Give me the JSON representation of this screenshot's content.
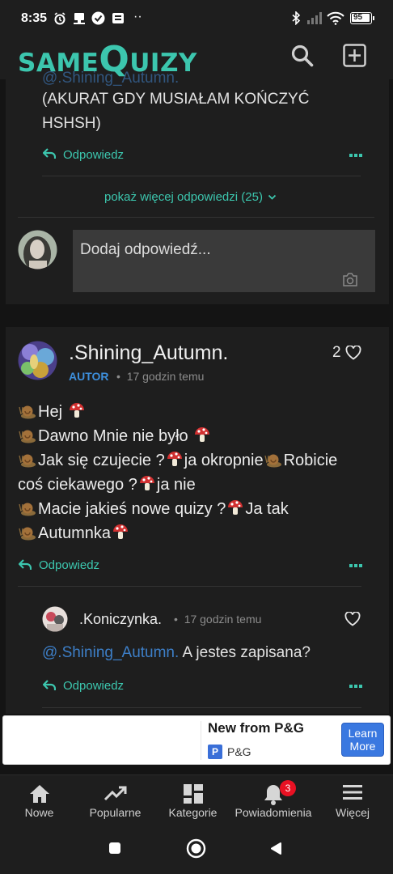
{
  "status_bar": {
    "time": "8:35",
    "battery": "95"
  },
  "app": {
    "logo_same": "same",
    "logo_q": "Q",
    "logo_uizy": "uizy"
  },
  "top_thread": {
    "mention_partial": "@.Shining_Autumn.",
    "text_line1": "(AKURAT GDY MUSIAŁAM KOŃCZYĆ",
    "text_line2": "HSHSH)",
    "reply_label": "Odpowiedz",
    "show_more": "pokaż więcej odpowiedzi (25)",
    "add_reply_placeholder": "Dodaj odpowiedź..."
  },
  "comment": {
    "author": ".Shining_Autumn.",
    "badge": "AUTOR",
    "time": "17 godzin temu",
    "likes": "2",
    "lines": [
      "Hej",
      "Dawno Mnie nie było",
      "Jak się czujecie ?",
      "ja okropnie",
      "Robicie",
      "coś ciekawego ?",
      "ja nie",
      "Macie jakieś nowe quizy ?",
      "Ja tak",
      "Autumnka"
    ],
    "reply_label": "Odpowiedz"
  },
  "reply": {
    "author": ".Koniczynka.",
    "time": "17 godzin temu",
    "mention": "@.Shining_Autumn.",
    "text": "A jestes zapisana?",
    "reply_label": "Odpowiedz"
  },
  "ad": {
    "title": "New from P&G",
    "brand_letter": "P",
    "brand": "P&G",
    "cta_line1": "Learn",
    "cta_line2": "More"
  },
  "nav": {
    "items": [
      {
        "label": "Nowe",
        "icon": "home-icon"
      },
      {
        "label": "Popularne",
        "icon": "trending-icon"
      },
      {
        "label": "Kategorie",
        "icon": "grid-icon"
      },
      {
        "label": "Powiadomienia",
        "icon": "bell-icon"
      },
      {
        "label": "Więcej",
        "icon": "menu-icon"
      }
    ],
    "notification_count": "3"
  },
  "colors": {
    "accent": "#3cc6ae",
    "background": "#141414",
    "card": "#1e1e1e",
    "badge_blue": "#3d8fdc",
    "notif_red": "#e81123"
  }
}
